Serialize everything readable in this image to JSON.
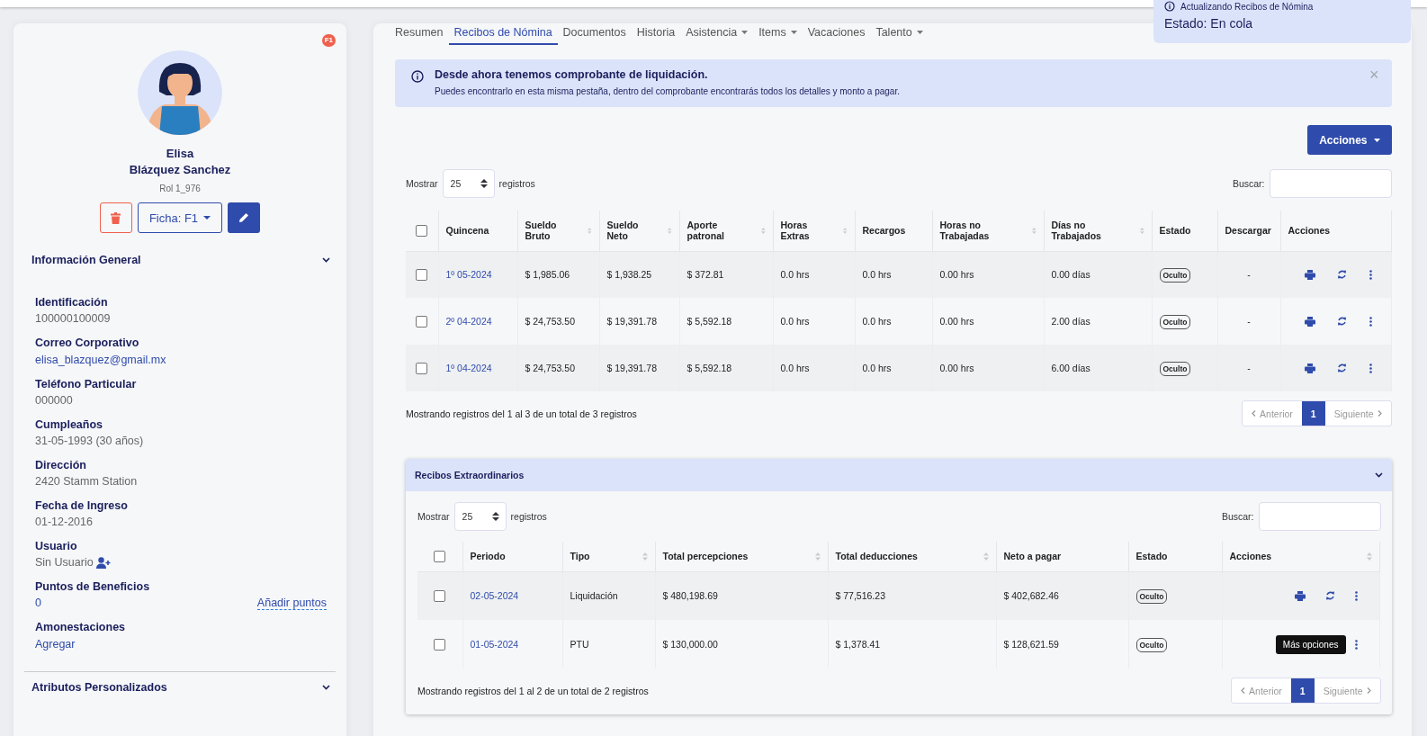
{
  "profile": {
    "badge": "F1",
    "first_name": "Elisa",
    "last_name": "Blázquez Sanchez",
    "role": "Rol 1_976",
    "ficha_button": "Ficha: F1"
  },
  "general_section": {
    "title": "Información General",
    "expanded": true,
    "fields": [
      {
        "label": "Identificación",
        "value": "100000100009",
        "kind": "text"
      },
      {
        "label": "Correo Corporativo",
        "value": "elisa_blazquez@gmail.mx",
        "kind": "link"
      },
      {
        "label": "Teléfono Particular",
        "value": "000000",
        "kind": "text"
      },
      {
        "label": "Cumpleaños",
        "value": "31-05-1993 (30 años)",
        "kind": "text"
      },
      {
        "label": "Dirección",
        "value": "2420 Stamm Station",
        "kind": "text"
      },
      {
        "label": "Fecha de Ingreso",
        "value": "01-12-2016",
        "kind": "text"
      },
      {
        "label": "Usuario",
        "value": "Sin Usuario",
        "kind": "user"
      },
      {
        "label": "Puntos de Beneficios",
        "value": "0",
        "kind": "points",
        "action": "Añadir puntos"
      },
      {
        "label": "Amonestaciones",
        "value": "Agregar",
        "kind": "link"
      }
    ]
  },
  "custom_section": {
    "title": "Atributos Personalizados",
    "expanded": false
  },
  "tabs": [
    {
      "label": "Resumen",
      "selected": false,
      "dropdown": false
    },
    {
      "label": "Recibos de Nómina",
      "selected": true,
      "dropdown": false
    },
    {
      "label": "Documentos",
      "selected": false,
      "dropdown": false
    },
    {
      "label": "Historia",
      "selected": false,
      "dropdown": false
    },
    {
      "label": "Asistencia",
      "selected": false,
      "dropdown": true
    },
    {
      "label": "Items",
      "selected": false,
      "dropdown": true
    },
    {
      "label": "Vacaciones",
      "selected": false,
      "dropdown": false
    },
    {
      "label": "Talento",
      "selected": false,
      "dropdown": true
    }
  ],
  "toast": {
    "title": "Actualizando Recibos de Nómina",
    "status": "Estado: En cola"
  },
  "alert": {
    "title": "Desde ahora tenemos comprobante de liquidación.",
    "text": "Puedes encontrarlo en esta misma pestaña, dentro del comprobante encontrarás todos los detalles y monto a pagar.",
    "close": "×"
  },
  "actions_button": "Acciones",
  "payroll_table": {
    "select_all_checked": false,
    "show_label": "Mostrar",
    "page_size": "25",
    "records_label": "registros",
    "search_label": "Buscar:",
    "columns": [
      {
        "label": "Quincena",
        "sortable": false
      },
      {
        "label": "Sueldo Bruto",
        "sortable": true
      },
      {
        "label": "Sueldo Neto",
        "sortable": true
      },
      {
        "label": "Aporte patronal",
        "sortable": true
      },
      {
        "label": "Horas Extras",
        "sortable": true
      },
      {
        "label": "Recargos",
        "sortable": false
      },
      {
        "label": "Horas no Trabajadas",
        "sortable": true
      },
      {
        "label": "Días no Trabajados",
        "sortable": true
      },
      {
        "label": "Estado",
        "sortable": false
      },
      {
        "label": "Descargar",
        "sortable": false
      },
      {
        "label": "Acciones",
        "sortable": false
      }
    ],
    "rows": [
      {
        "checked": false,
        "cells": [
          "1º 05-2024",
          "$ 1,985.06",
          "$ 1,938.25",
          "$ 372.81",
          "0.0 hrs",
          "0.0 hrs",
          "0.00 hrs",
          "0.00 días"
        ],
        "status": "Oculto",
        "download": "-"
      },
      {
        "checked": false,
        "cells": [
          "2º 04-2024",
          "$ 24,753.50",
          "$ 19,391.78",
          "$ 5,592.18",
          "0.0 hrs",
          "0.0 hrs",
          "0.00 hrs",
          "2.00 días"
        ],
        "status": "Oculto",
        "download": "-"
      },
      {
        "checked": false,
        "cells": [
          "1º 04-2024",
          "$ 24,753.50",
          "$ 19,391.78",
          "$ 5,592.18",
          "0.0 hrs",
          "0.0 hrs",
          "0.00 hrs",
          "6.00 días"
        ],
        "status": "Oculto",
        "download": "-"
      }
    ],
    "info": "Mostrando registros del 1 al 3 de un total de 3 registros",
    "pagination": {
      "previous": "Anterior",
      "pages": [
        {
          "label": "1",
          "selected": true
        }
      ],
      "next": "Siguiente"
    }
  },
  "extra_section": {
    "title": "Recibos Extraordinarios",
    "expanded": true,
    "select_all_checked": false,
    "show_label": "Mostrar",
    "page_size": "25",
    "records_label": "registros",
    "search_label": "Buscar:",
    "columns": [
      {
        "label": "Periodo",
        "sortable": false
      },
      {
        "label": "Tipo",
        "sortable": true
      },
      {
        "label": "Total percepciones",
        "sortable": true
      },
      {
        "label": "Total deducciones",
        "sortable": true
      },
      {
        "label": "Neto a pagar",
        "sortable": false
      },
      {
        "label": "Estado",
        "sortable": false
      },
      {
        "label": "Acciones",
        "sortable": true
      }
    ],
    "rows": [
      {
        "checked": false,
        "cells": [
          "02-05-2024",
          "Liquidación",
          "$ 480,198.69",
          "$ 77,516.23",
          "$ 402,682.46"
        ],
        "status": "Oculto"
      },
      {
        "checked": false,
        "cells": [
          "01-05-2024",
          "PTU",
          "$ 130,000.00",
          "$ 1,378.41",
          "$ 128,621.59"
        ],
        "status": "Oculto",
        "tooltip": "Más opciones"
      }
    ],
    "info": "Mostrando registros del 1 al 2 de un total de 2 registros",
    "pagination": {
      "previous": "Anterior",
      "pages": [
        {
          "label": "1",
          "selected": true
        }
      ],
      "next": "Siguiente"
    }
  }
}
